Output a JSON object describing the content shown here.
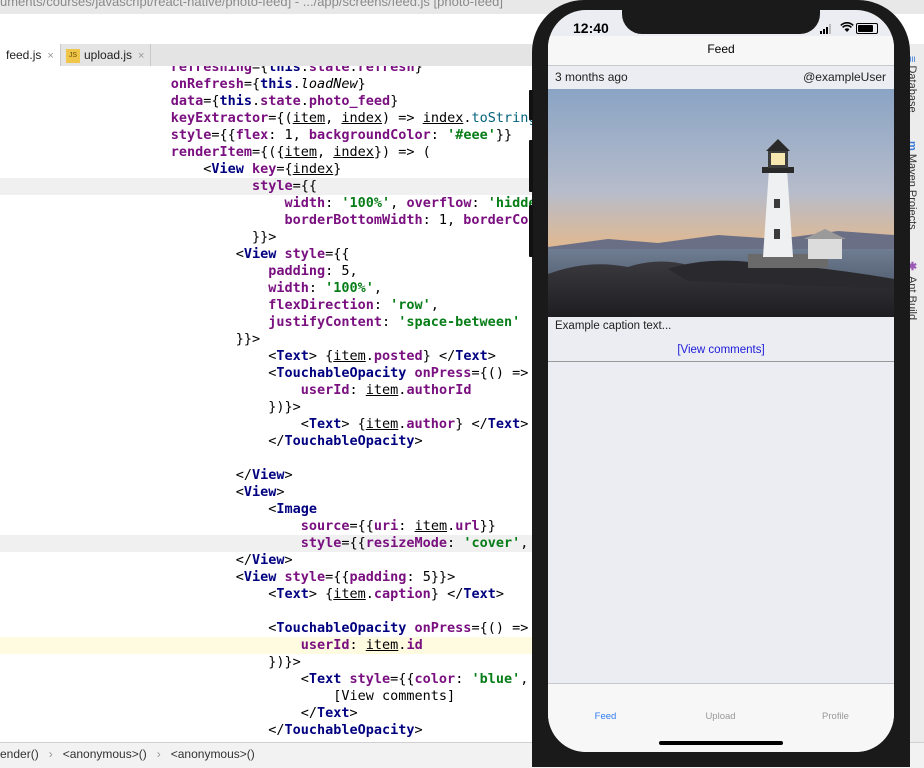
{
  "ide": {
    "title": "uments/courses/javascript/react-native/photo-feed] - .../app/screens/feed.js [photo-feed]",
    "tabs": [
      {
        "label": "feed.js",
        "close": "×"
      },
      {
        "label": "upload.js",
        "close": "×",
        "icon": "JS"
      }
    ],
    "right_rail": [
      "Database",
      "Maven Projects",
      "Ant Build"
    ],
    "breadcrumbs": [
      "ender()",
      "<anonymous>()",
      "<anonymous>()"
    ],
    "breadcrumb_sep": "›"
  },
  "phone": {
    "time": "12:40",
    "nav_title": "Feed",
    "post": {
      "posted": "3 months ago",
      "author": "@exampleUser",
      "caption": "Example caption text...",
      "view_comments": "[View comments]"
    },
    "tabs": [
      {
        "label": "Feed",
        "active": true
      },
      {
        "label": "Upload",
        "active": false
      },
      {
        "label": "Profile",
        "active": false
      }
    ],
    "colors": {
      "accent": "#2f7cf6",
      "link": "#1b1bd8",
      "background": "#ecedf2"
    }
  }
}
